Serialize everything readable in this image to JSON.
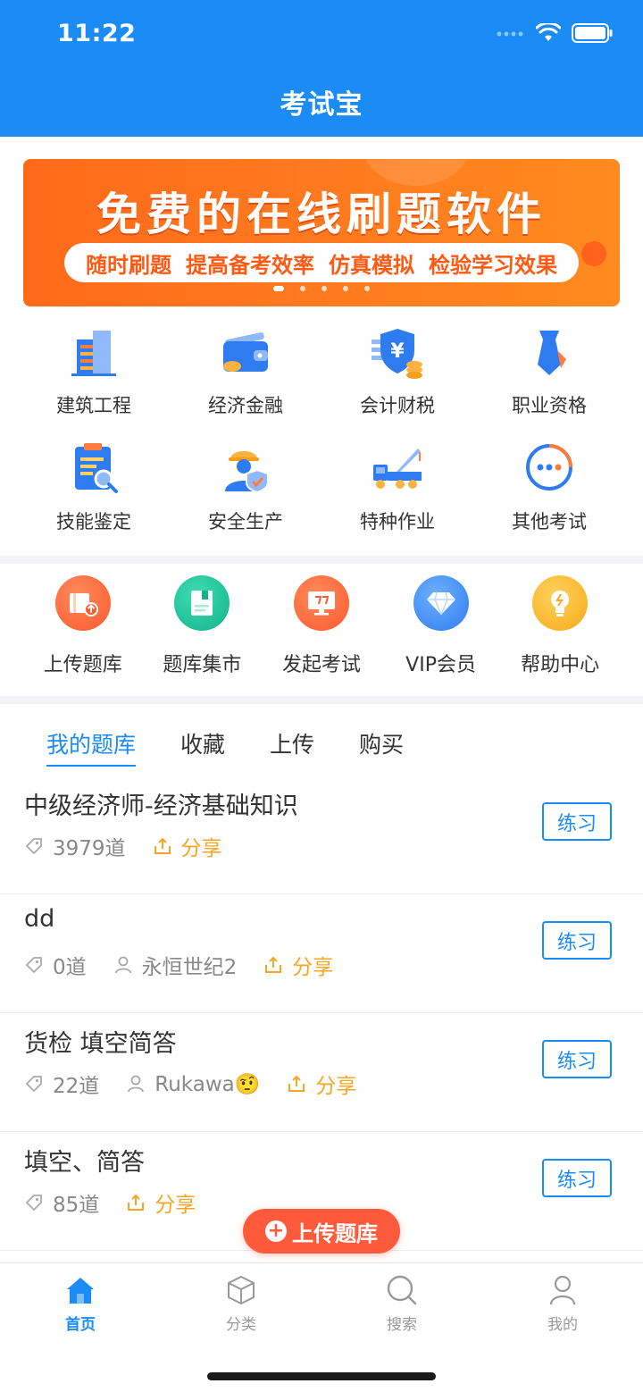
{
  "status_bar": {
    "time": "11:22"
  },
  "header": {
    "title": "考试宝"
  },
  "banner": {
    "headline": "免费的在线刷题软件",
    "tagline": [
      "随时刷题",
      "提高备考效率",
      "仿真模拟",
      "检验学习效果"
    ],
    "active_dot": 1,
    "dot_count": 5
  },
  "categories": [
    {
      "label": "建筑工程",
      "icon": "building-icon"
    },
    {
      "label": "经济金融",
      "icon": "wallet-icon"
    },
    {
      "label": "会计财税",
      "icon": "yuan-shield-icon"
    },
    {
      "label": "职业资格",
      "icon": "tie-icon"
    },
    {
      "label": "技能鉴定",
      "icon": "clipboard-search-icon"
    },
    {
      "label": "安全生产",
      "icon": "worker-icon"
    },
    {
      "label": "特种作业",
      "icon": "crane-truck-icon"
    },
    {
      "label": "其他考试",
      "icon": "more-dots-icon"
    }
  ],
  "tools": [
    {
      "label": "上传题库",
      "icon": "upload-book-icon",
      "color": "#ff6a3d"
    },
    {
      "label": "题库集市",
      "icon": "book-market-icon",
      "color": "#1ec29a"
    },
    {
      "label": "发起考试",
      "icon": "exam-screen-icon",
      "color": "#ff6a3d"
    },
    {
      "label": "VIP会员",
      "icon": "diamond-icon",
      "color": "#3b8ff5"
    },
    {
      "label": "帮助中心",
      "icon": "lightbulb-icon",
      "color": "#f7b52c"
    }
  ],
  "tabs": [
    {
      "label": "我的题库",
      "active": true
    },
    {
      "label": "收藏",
      "active": false
    },
    {
      "label": "上传",
      "active": false
    },
    {
      "label": "购买",
      "active": false
    }
  ],
  "banks": [
    {
      "title": "中级经济师-经济基础知识",
      "count": "3979道",
      "author": "",
      "share": "分享",
      "action": "练习"
    },
    {
      "title": "dd",
      "count": "0道",
      "author": "永恒世纪2",
      "share": "分享",
      "action": "练习"
    },
    {
      "title": "货检 填空简答",
      "count": "22道",
      "author": "Rukawa🤨",
      "share": "分享",
      "action": "练习"
    },
    {
      "title": "填空、简答",
      "count": "85道",
      "author": "",
      "share": "分享",
      "action": "练习"
    }
  ],
  "float_button": {
    "label": "上传题库"
  },
  "bottom_nav": [
    {
      "label": "首页",
      "icon": "home-icon",
      "active": true
    },
    {
      "label": "分类",
      "icon": "cube-icon",
      "active": false
    },
    {
      "label": "搜索",
      "icon": "search-icon",
      "active": false
    },
    {
      "label": "我的",
      "icon": "person-icon",
      "active": false
    }
  ],
  "colors": {
    "primary": "#1b8cf5",
    "banner": "#ff7a1e",
    "share": "#f5a623",
    "upload": "#ff5a3c"
  }
}
